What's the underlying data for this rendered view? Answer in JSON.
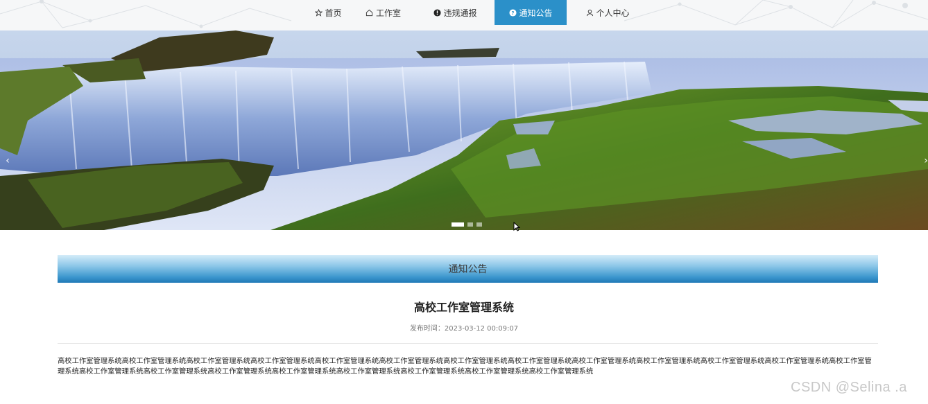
{
  "nav": {
    "items": [
      {
        "label": "首页",
        "icon": "star-outline-icon"
      },
      {
        "label": "工作室",
        "icon": "home-icon"
      },
      {
        "label": "违规通报",
        "icon": "exclamation-circle-icon"
      },
      {
        "label": "通知公告",
        "icon": "question-circle-icon",
        "active": true
      },
      {
        "label": "个人中心",
        "icon": "user-icon"
      }
    ],
    "active_color": "#2b90c9"
  },
  "banner": {
    "prev_label": "‹",
    "next_label": "›",
    "slide_count": 3,
    "active_slide": 1
  },
  "section": {
    "title": "通知公告"
  },
  "article": {
    "title": "高校工作室管理系统",
    "meta": "发布时间：2023-03-12 00:09:07",
    "body": "高校工作室管理系统高校工作室管理系统高校工作室管理系统高校工作室管理系统高校工作室管理系统高校工作室管理系统高校工作室管理系统高校工作室管理系统高校工作室管理系统高校工作室管理系统高校工作室管理系统高校工作室管理系统高校工作室管理系统高校工作室管理系统高校工作室管理系统高校工作室管理系统高校工作室管理系统高校工作室管理系统高校工作室管理系统高校工作室管理系统高校工作室管理系统"
  },
  "watermark": "CSDN @Selina .a"
}
